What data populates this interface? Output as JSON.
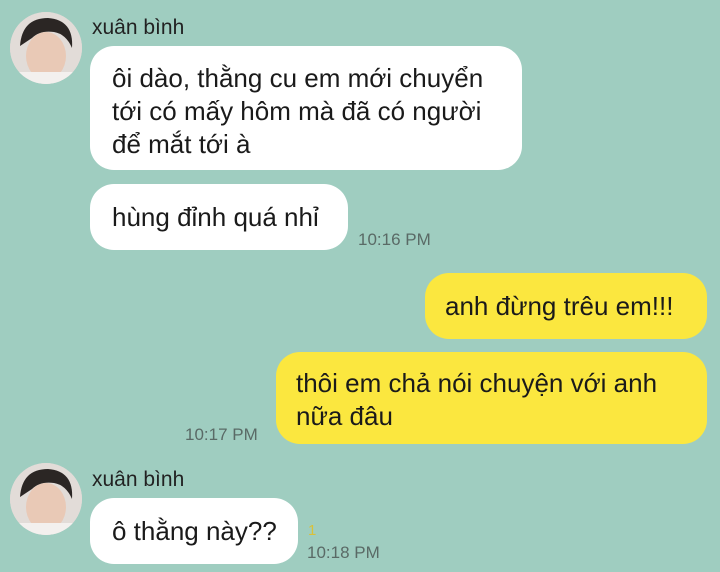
{
  "chat": {
    "groups": [
      {
        "sender": "xuân bình",
        "messages": [
          {
            "text": "ôi dào, thằng cu em mới chuyển tới có mấy hôm mà đã có người để mắt tới à"
          },
          {
            "text": "hùng đỉnh quá nhỉ",
            "time": "10:16 PM"
          }
        ]
      },
      {
        "sender": "me",
        "messages": [
          {
            "text": "anh đừng trêu em!!!"
          },
          {
            "text": "thôi em chả nói chuyện với anh nữa đâu",
            "time": "10:17 PM"
          }
        ]
      },
      {
        "sender": "xuân bình",
        "messages": [
          {
            "text": "ô thằng này??",
            "time": "10:18 PM",
            "unread": "1"
          }
        ]
      }
    ]
  },
  "colors": {
    "background": "#9fcdc0",
    "incoming_bubble": "#ffffff",
    "outgoing_bubble": "#fbe73f"
  }
}
